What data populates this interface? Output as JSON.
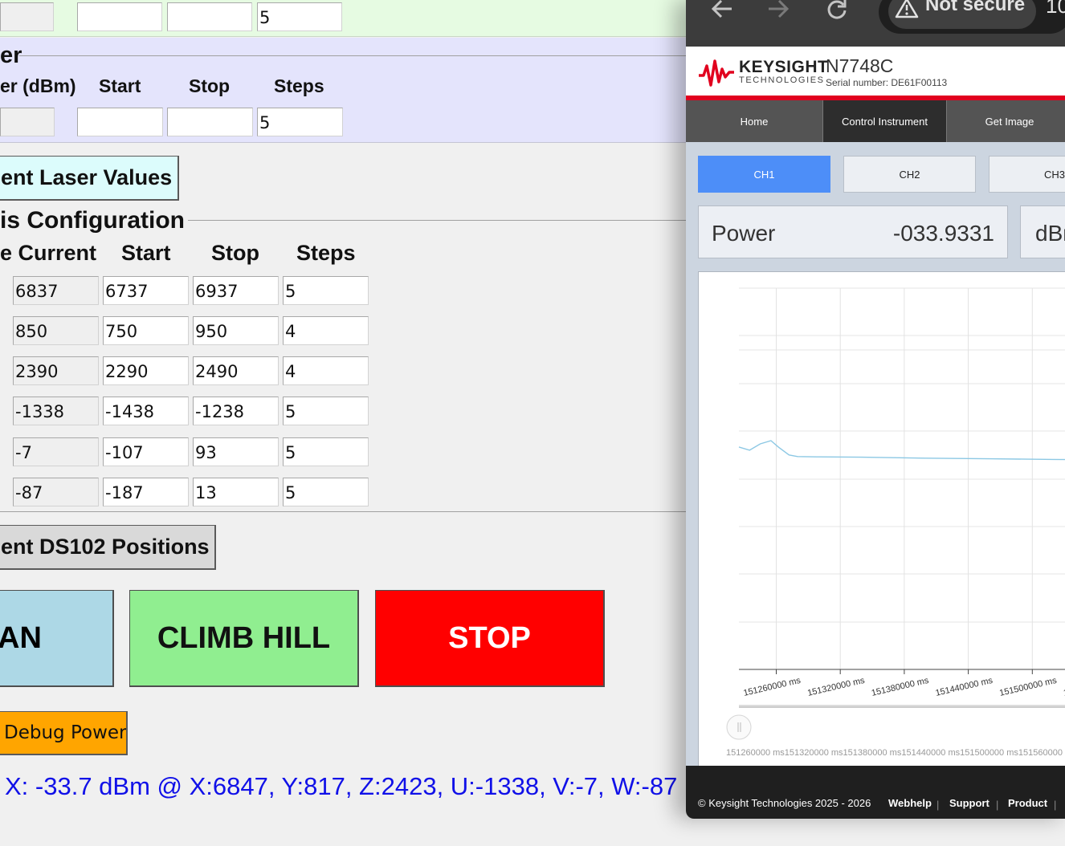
{
  "laser_tab": {
    "steps_value": "5"
  },
  "power_section": {
    "title_fragment": "er",
    "headers": {
      "power": "er (dBm)",
      "start": "Start",
      "stop": "Stop",
      "steps": "Steps"
    },
    "steps_value": "5",
    "button_label": "ent Laser Values"
  },
  "axis_section": {
    "title_fragment": "is Configuration",
    "headers": {
      "current": "e  Current",
      "start": "Start",
      "stop": "Stop",
      "steps": "Steps"
    },
    "rows": [
      {
        "current": "6837",
        "start": "6737",
        "stop": "6937",
        "steps": "5"
      },
      {
        "current": "850",
        "start": "750",
        "stop": "950",
        "steps": "4"
      },
      {
        "current": "2390",
        "start": "2290",
        "stop": "2490",
        "steps": "4"
      },
      {
        "current": "-1338",
        "start": "-1438",
        "stop": "-1238",
        "steps": "5"
      },
      {
        "current": "-7",
        "start": "-107",
        "stop": "93",
        "steps": "5"
      },
      {
        "current": "-87",
        "start": "-187",
        "stop": "13",
        "steps": "5"
      }
    ],
    "button_label": "ent DS102 Positions"
  },
  "actions": {
    "scan_label": "AN",
    "climb_label": "CLIMB HILL",
    "stop_label": "STOP",
    "debug_label": "Debug Power",
    "colors": {
      "scan": "#add8e6",
      "climb": "#90ee90",
      "stop": "#ff0000",
      "debug": "#ffa500"
    }
  },
  "status_line": "X: -33.7 dBm @ X:6847, Y:817, Z:2423, U:-1338, V:-7, W:-87",
  "browser": {
    "security_label": "Not secure",
    "url_fragment": "10",
    "brand": "KEYSIGHT",
    "brand_sub": "TECHNOLOGIES",
    "model": "N7748C",
    "serial": "Serial number: DE61F00113",
    "tabs": [
      "Home",
      "Control Instrument",
      "Get Image"
    ],
    "channels": [
      "CH1",
      "CH2",
      "CH3"
    ],
    "power_label": "Power",
    "power_value": "-033.9331",
    "power_unit": "dBm",
    "footer": {
      "copyright": "© Keysight Technologies 2025 - 2026",
      "links": [
        "Webhelp",
        "Support",
        "Product"
      ]
    },
    "brand_color": "#e1001e",
    "active_channel_color": "#4d8ef8"
  },
  "chart_data": {
    "type": "line",
    "title": "",
    "xlabel": "",
    "ylabel": "",
    "x_tick_labels": [
      "151260000 ms",
      "151320000 ms",
      "151380000 ms",
      "151440000 ms",
      "151500000 ms",
      "151560000 ms"
    ],
    "x_ticks": [
      151260000,
      151320000,
      151380000,
      151440000,
      151500000,
      151560000
    ],
    "slider_tick_labels": [
      "151260000 ms",
      "151320000 ms",
      "151380000 ms",
      "151440000 ms",
      "151500000 ms",
      "151560000 ms"
    ],
    "xlim": [
      151225000,
      151560000
    ],
    "series": [
      {
        "x": [
          151225000,
          151235000,
          151245000,
          151255000,
          151262000,
          151272000,
          151280000,
          151300000,
          151340000,
          151400000,
          151460000,
          151520000,
          151560000
        ],
        "y": [
          -33.9,
          -33.91,
          -33.89,
          -33.88,
          -33.9,
          -33.925,
          -33.93,
          -33.931,
          -33.932,
          -33.935,
          -33.937,
          -33.939,
          -33.94
        ]
      }
    ],
    "line_color": "#8cc8e4",
    "grid": true
  }
}
